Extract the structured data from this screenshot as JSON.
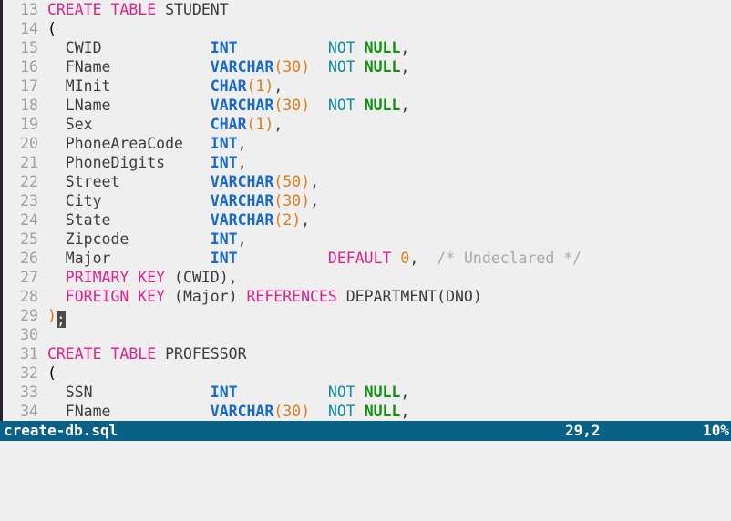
{
  "window": {
    "kind": "terminal-text-editor",
    "background_color": "#efefef",
    "foreground_color": "#3c3c3c"
  },
  "editor": {
    "first_visible_line": 13,
    "last_visible_line": 34,
    "gutter_color": "#9aa0a6",
    "lines": [
      {
        "n": "13",
        "text": "CREATE TABLE STUDENT"
      },
      {
        "n": "14",
        "text": "("
      },
      {
        "n": "15",
        "text": "  CWID            INT          NOT NULL,"
      },
      {
        "n": "16",
        "text": "  FName           VARCHAR(30)  NOT NULL,"
      },
      {
        "n": "17",
        "text": "  MInit           CHAR(1),"
      },
      {
        "n": "18",
        "text": "  LName           VARCHAR(30)  NOT NULL,"
      },
      {
        "n": "19",
        "text": "  Sex             CHAR(1),"
      },
      {
        "n": "20",
        "text": "  PhoneAreaCode   INT,"
      },
      {
        "n": "21",
        "text": "  PhoneDigits     INT,"
      },
      {
        "n": "22",
        "text": "  Street          VARCHAR(50),"
      },
      {
        "n": "23",
        "text": "  City            VARCHAR(30),"
      },
      {
        "n": "24",
        "text": "  State           VARCHAR(2),"
      },
      {
        "n": "25",
        "text": "  Zipcode         INT,"
      },
      {
        "n": "26",
        "text": "  Major           INT          DEFAULT 0,  /* Undeclared */"
      },
      {
        "n": "27",
        "text": "  PRIMARY KEY (CWID),"
      },
      {
        "n": "28",
        "text": "  FOREIGN KEY (Major) REFERENCES DEPARTMENT(DNO)"
      },
      {
        "n": "29",
        "text": ");"
      },
      {
        "n": "30",
        "text": ""
      },
      {
        "n": "31",
        "text": "CREATE TABLE PROFESSOR"
      },
      {
        "n": "32",
        "text": "("
      },
      {
        "n": "33",
        "text": "  SSN             INT          NOT NULL,"
      },
      {
        "n": "34",
        "text": "  FName           VARCHAR(30)  NOT NULL,"
      }
    ],
    "cursor": {
      "line": 29,
      "column": 2,
      "character": ";"
    },
    "colors": {
      "keyword": "#e0218a",
      "type": "#1769cc",
      "number": "#e07b18",
      "not": "#108a9c",
      "null": "#109010",
      "identifier": "#3c3c3c",
      "comment": "#a8a8a8",
      "cursor_block": "#4a4a4a"
    }
  },
  "statusbar": {
    "filename": "create-db.sql",
    "position": "29,2",
    "percent": "10%",
    "background_color": "#0a6186",
    "text_color": "#ffffff"
  },
  "commandline": {
    "text": ""
  }
}
